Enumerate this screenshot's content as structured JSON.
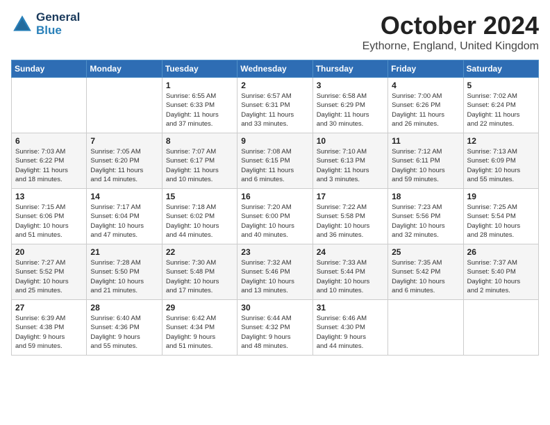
{
  "header": {
    "logo_line1": "General",
    "logo_line2": "Blue",
    "month_title": "October 2024",
    "location": "Eythorne, England, United Kingdom"
  },
  "weekdays": [
    "Sunday",
    "Monday",
    "Tuesday",
    "Wednesday",
    "Thursday",
    "Friday",
    "Saturday"
  ],
  "weeks": [
    [
      {
        "day": "",
        "info": ""
      },
      {
        "day": "",
        "info": ""
      },
      {
        "day": "1",
        "info": "Sunrise: 6:55 AM\nSunset: 6:33 PM\nDaylight: 11 hours\nand 37 minutes."
      },
      {
        "day": "2",
        "info": "Sunrise: 6:57 AM\nSunset: 6:31 PM\nDaylight: 11 hours\nand 33 minutes."
      },
      {
        "day": "3",
        "info": "Sunrise: 6:58 AM\nSunset: 6:29 PM\nDaylight: 11 hours\nand 30 minutes."
      },
      {
        "day": "4",
        "info": "Sunrise: 7:00 AM\nSunset: 6:26 PM\nDaylight: 11 hours\nand 26 minutes."
      },
      {
        "day": "5",
        "info": "Sunrise: 7:02 AM\nSunset: 6:24 PM\nDaylight: 11 hours\nand 22 minutes."
      }
    ],
    [
      {
        "day": "6",
        "info": "Sunrise: 7:03 AM\nSunset: 6:22 PM\nDaylight: 11 hours\nand 18 minutes."
      },
      {
        "day": "7",
        "info": "Sunrise: 7:05 AM\nSunset: 6:20 PM\nDaylight: 11 hours\nand 14 minutes."
      },
      {
        "day": "8",
        "info": "Sunrise: 7:07 AM\nSunset: 6:17 PM\nDaylight: 11 hours\nand 10 minutes."
      },
      {
        "day": "9",
        "info": "Sunrise: 7:08 AM\nSunset: 6:15 PM\nDaylight: 11 hours\nand 6 minutes."
      },
      {
        "day": "10",
        "info": "Sunrise: 7:10 AM\nSunset: 6:13 PM\nDaylight: 11 hours\nand 3 minutes."
      },
      {
        "day": "11",
        "info": "Sunrise: 7:12 AM\nSunset: 6:11 PM\nDaylight: 10 hours\nand 59 minutes."
      },
      {
        "day": "12",
        "info": "Sunrise: 7:13 AM\nSunset: 6:09 PM\nDaylight: 10 hours\nand 55 minutes."
      }
    ],
    [
      {
        "day": "13",
        "info": "Sunrise: 7:15 AM\nSunset: 6:06 PM\nDaylight: 10 hours\nand 51 minutes."
      },
      {
        "day": "14",
        "info": "Sunrise: 7:17 AM\nSunset: 6:04 PM\nDaylight: 10 hours\nand 47 minutes."
      },
      {
        "day": "15",
        "info": "Sunrise: 7:18 AM\nSunset: 6:02 PM\nDaylight: 10 hours\nand 44 minutes."
      },
      {
        "day": "16",
        "info": "Sunrise: 7:20 AM\nSunset: 6:00 PM\nDaylight: 10 hours\nand 40 minutes."
      },
      {
        "day": "17",
        "info": "Sunrise: 7:22 AM\nSunset: 5:58 PM\nDaylight: 10 hours\nand 36 minutes."
      },
      {
        "day": "18",
        "info": "Sunrise: 7:23 AM\nSunset: 5:56 PM\nDaylight: 10 hours\nand 32 minutes."
      },
      {
        "day": "19",
        "info": "Sunrise: 7:25 AM\nSunset: 5:54 PM\nDaylight: 10 hours\nand 28 minutes."
      }
    ],
    [
      {
        "day": "20",
        "info": "Sunrise: 7:27 AM\nSunset: 5:52 PM\nDaylight: 10 hours\nand 25 minutes."
      },
      {
        "day": "21",
        "info": "Sunrise: 7:28 AM\nSunset: 5:50 PM\nDaylight: 10 hours\nand 21 minutes."
      },
      {
        "day": "22",
        "info": "Sunrise: 7:30 AM\nSunset: 5:48 PM\nDaylight: 10 hours\nand 17 minutes."
      },
      {
        "day": "23",
        "info": "Sunrise: 7:32 AM\nSunset: 5:46 PM\nDaylight: 10 hours\nand 13 minutes."
      },
      {
        "day": "24",
        "info": "Sunrise: 7:33 AM\nSunset: 5:44 PM\nDaylight: 10 hours\nand 10 minutes."
      },
      {
        "day": "25",
        "info": "Sunrise: 7:35 AM\nSunset: 5:42 PM\nDaylight: 10 hours\nand 6 minutes."
      },
      {
        "day": "26",
        "info": "Sunrise: 7:37 AM\nSunset: 5:40 PM\nDaylight: 10 hours\nand 2 minutes."
      }
    ],
    [
      {
        "day": "27",
        "info": "Sunrise: 6:39 AM\nSunset: 4:38 PM\nDaylight: 9 hours\nand 59 minutes."
      },
      {
        "day": "28",
        "info": "Sunrise: 6:40 AM\nSunset: 4:36 PM\nDaylight: 9 hours\nand 55 minutes."
      },
      {
        "day": "29",
        "info": "Sunrise: 6:42 AM\nSunset: 4:34 PM\nDaylight: 9 hours\nand 51 minutes."
      },
      {
        "day": "30",
        "info": "Sunrise: 6:44 AM\nSunset: 4:32 PM\nDaylight: 9 hours\nand 48 minutes."
      },
      {
        "day": "31",
        "info": "Sunrise: 6:46 AM\nSunset: 4:30 PM\nDaylight: 9 hours\nand 44 minutes."
      },
      {
        "day": "",
        "info": ""
      },
      {
        "day": "",
        "info": ""
      }
    ]
  ]
}
